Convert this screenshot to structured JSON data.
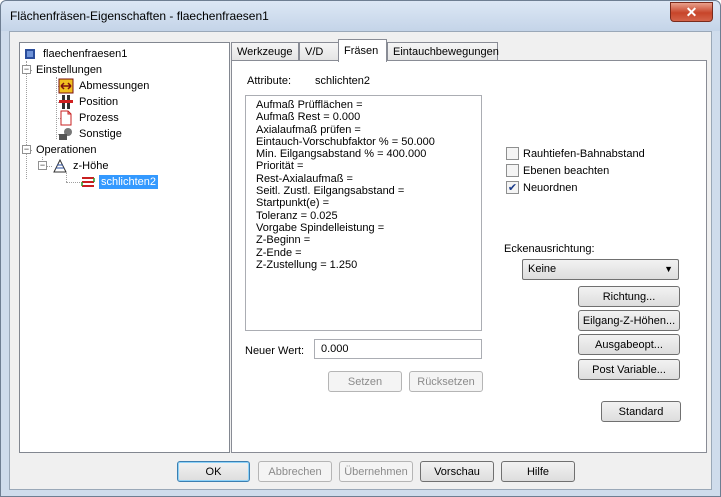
{
  "window": {
    "title": "Flächenfräsen-Eigenschaften - flaechenfraesen1",
    "close_label": "✕"
  },
  "tree": {
    "root": "flaechenfraesen1",
    "settings": "Einstellungen",
    "settings_items": [
      "Abmessungen",
      "Position",
      "Prozess",
      "Sonstige"
    ],
    "operations": "Operationen",
    "op_item": "z-Höhe",
    "op_sub": "schlichten2"
  },
  "tabs": [
    "Werkzeuge",
    "V/D",
    "Fräsen",
    "Eintauchbewegungen"
  ],
  "attributes": {
    "label": "Attribute:",
    "value": "schlichten2",
    "lines": [
      "Aufmaß Prüfflächen =",
      "Aufmaß Rest = 0.000",
      "Axialaufmaß prüfen =",
      "Eintauch-Vorschubfaktor % = 50.000",
      "Min. Eilgangsabstand % = 400.000",
      "Priorität =",
      "Rest-Axialaufmaß =",
      "Seitl. Zustl. Eilgangsabstand =",
      "Startpunkt(e) =",
      "Toleranz = 0.025",
      "Vorgabe Spindelleistung =",
      "Z-Beginn =",
      "Z-Ende =",
      "Z-Zustellung = 1.250"
    ]
  },
  "new_value": {
    "label": "Neuer Wert:",
    "value": "0.000"
  },
  "buttons": {
    "setzen": "Setzen",
    "ruecksetzen": "Rücksetzen",
    "richtung": "Richtung...",
    "eilgang": "Eilgang-Z-Höhen...",
    "ausgabe": "Ausgabeopt...",
    "post": "Post Variable...",
    "standard": "Standard",
    "ok": "OK",
    "abbrechen": "Abbrechen",
    "uebernehmen": "Übernehmen",
    "vorschau": "Vorschau",
    "hilfe": "Hilfe"
  },
  "checkboxes": [
    {
      "label": "Rauhtiefen-Bahnabstand",
      "checked": false
    },
    {
      "label": "Ebenen beachten",
      "checked": false
    },
    {
      "label": "Neuordnen",
      "checked": true
    }
  ],
  "corner": {
    "label": "Eckenausrichtung:",
    "selected": "Keine"
  }
}
